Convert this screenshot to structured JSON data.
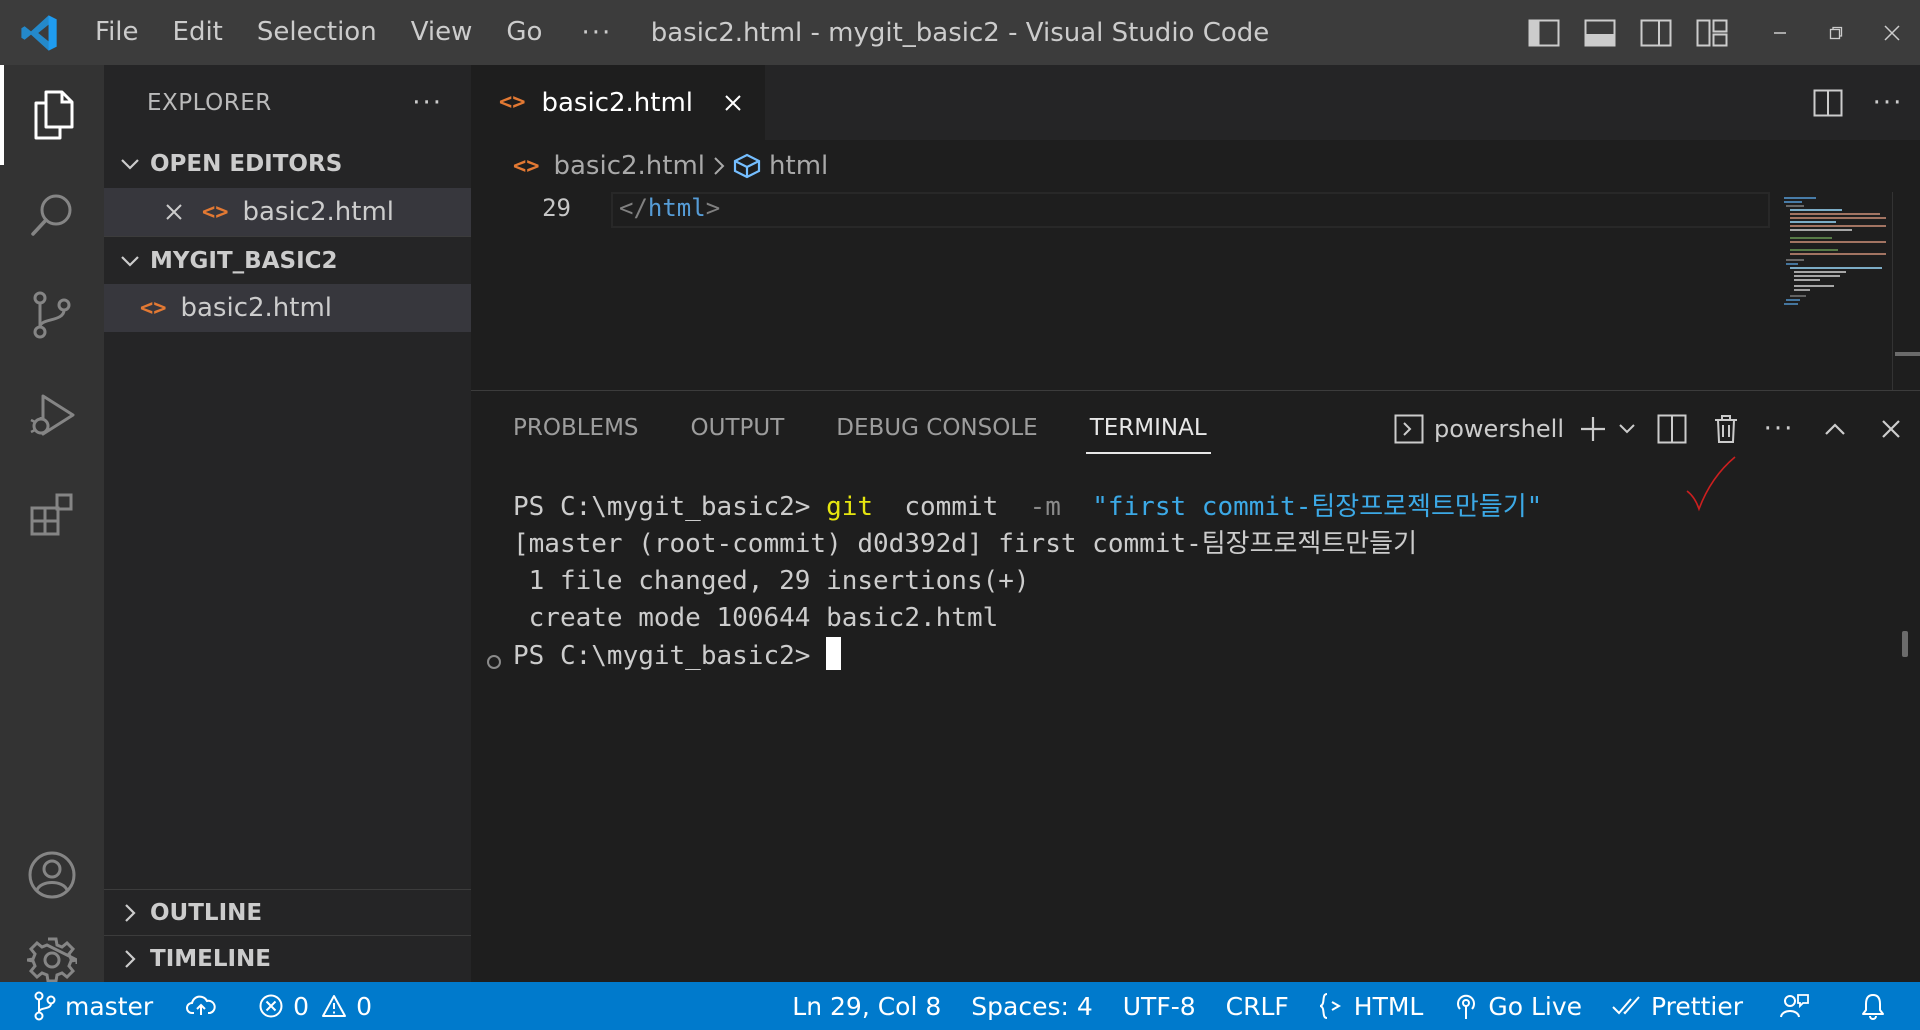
{
  "window": {
    "title": "basic2.html - mygit_basic2 - Visual Studio Code",
    "menu": [
      "File",
      "Edit",
      "Selection",
      "View",
      "Go"
    ],
    "menu_more": "···"
  },
  "sidebar": {
    "title": "EXPLORER",
    "more": "···",
    "open_editors": {
      "label": "OPEN EDITORS",
      "files": [
        "basic2.html"
      ]
    },
    "folder": {
      "label": "MYGIT_BASIC2",
      "files": [
        "basic2.html"
      ]
    },
    "outline": "OUTLINE",
    "timeline": "TIMELINE"
  },
  "editor": {
    "tab": {
      "label": "basic2.html"
    },
    "breadcrumb": {
      "file": "basic2.html",
      "symbol": "html"
    },
    "line_number": "29",
    "code": {
      "open": "</",
      "tag": "html",
      "close": ">"
    },
    "more": "···"
  },
  "panel": {
    "tabs": [
      "PROBLEMS",
      "OUTPUT",
      "DEBUG CONSOLE",
      "TERMINAL"
    ],
    "active_tab": "TERMINAL",
    "shell": "powershell",
    "more": "···",
    "terminal": {
      "prompt": "PS C:\\mygit_basic2> ",
      "cmd_git": "git",
      "cmd_commit": "  commit  ",
      "cmd_flag": "-m",
      "cmd_msg": "  \"first commit-팀장프로젝트만들기\"",
      "out1": "[master (root-commit) d0d392d] first commit-팀장프로젝트만들기",
      "out2": " 1 file changed, 29 insertions(+)",
      "out3": " create mode 100644 basic2.html",
      "prompt2": "PS C:\\mygit_basic2> "
    }
  },
  "status": {
    "branch": "master",
    "errors": "0",
    "warnings": "0",
    "position": "Ln 29, Col 8",
    "spaces": "Spaces: 4",
    "encoding": "UTF-8",
    "eol": "CRLF",
    "language": "HTML",
    "golive": "Go Live",
    "prettier": "Prettier"
  },
  "colors": {
    "titlebar": "#3c3c3c",
    "activitybar": "#333333",
    "sidebar": "#252526",
    "editor": "#1e1e1e",
    "statusbar": "#007acc",
    "html_icon": "#e37933",
    "tag": "#569cd6",
    "string": "#3ca9e6",
    "git_cmd": "#e5e510"
  },
  "icons": {
    "activity": [
      "files-icon",
      "search-icon",
      "source-control-icon",
      "run-debug-icon",
      "extensions-icon",
      "account-icon",
      "settings-gear-icon"
    ]
  }
}
